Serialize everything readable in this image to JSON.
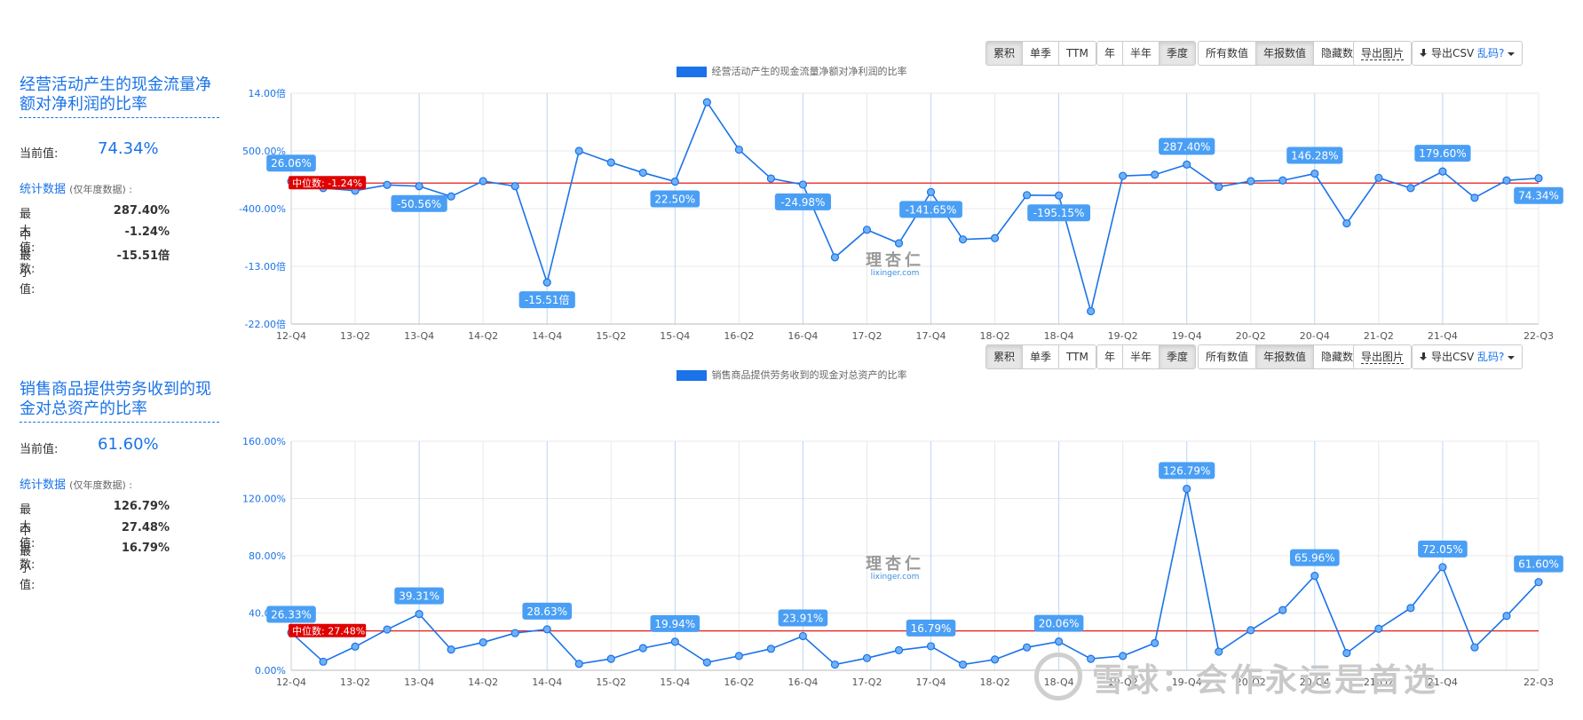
{
  "panels": [
    {
      "title": "经营活动产生的现金流量净额对净利润的比率",
      "current_label": "当前值:",
      "current_value": "74.34%",
      "stats_label": "统计数据",
      "stats_note": "(仅年度数据) :",
      "stats": [
        {
          "label": "最大值:",
          "value": "287.40%"
        },
        {
          "label": "中位数:",
          "value": "-1.24%"
        },
        {
          "label": "最小值:",
          "value": "-15.51倍"
        }
      ],
      "toolbar": {
        "group1": [
          "累积",
          "单季",
          "TTM"
        ],
        "group1_active": 0,
        "group2": [
          "年",
          "半年",
          "季度"
        ],
        "group2_active": 2,
        "group3": [
          "所有数值",
          "年报数值",
          "隐藏数值"
        ],
        "group3_active": 1,
        "export_image": "导出图片",
        "export_csv": "导出CSV",
        "garbled": "乱码?"
      }
    },
    {
      "title": "销售商品提供劳务收到的现金对总资产的比率",
      "current_label": "当前值:",
      "current_value": "61.60%",
      "stats_label": "统计数据",
      "stats_note": "(仅年度数据) :",
      "stats": [
        {
          "label": "最大值:",
          "value": "126.79%"
        },
        {
          "label": "中位数:",
          "value": "27.48%"
        },
        {
          "label": "最小值:",
          "value": "16.79%"
        }
      ],
      "toolbar": {
        "group1": [
          "累积",
          "单季",
          "TTM"
        ],
        "group1_active": 0,
        "group2": [
          "年",
          "半年",
          "季度"
        ],
        "group2_active": 2,
        "group3": [
          "所有数值",
          "年报数值",
          "隐藏数值"
        ],
        "group3_active": 1,
        "export_image": "导出图片",
        "export_csv": "导出CSV",
        "garbled": "乱码?"
      }
    }
  ],
  "watermarks": {
    "lixinger_cn": "理杏仁",
    "lixinger_en": "lixinger.com",
    "xueqiu": "雪球：会作永远是首选"
  },
  "colors": {
    "line": "#1a73e8",
    "median": "#e00000",
    "label_bg": "#4a9ff5",
    "grid": "#e8e8e8",
    "year_grid": "#b9d7f7"
  },
  "chart_data": [
    {
      "type": "line",
      "title": "",
      "legend": "经营活动产生的现金流量净额对净利润的比率",
      "x": [
        "12-Q4",
        "13-Q1",
        "13-Q2",
        "13-Q3",
        "13-Q4",
        "14-Q1",
        "14-Q2",
        "14-Q3",
        "14-Q4",
        "15-Q1",
        "15-Q2",
        "15-Q3",
        "15-Q4",
        "16-Q1",
        "16-Q2",
        "16-Q3",
        "16-Q4",
        "17-Q1",
        "17-Q2",
        "17-Q3",
        "17-Q4",
        "18-Q1",
        "18-Q2",
        "18-Q3",
        "18-Q4",
        "19-Q1",
        "19-Q2",
        "19-Q3",
        "19-Q4",
        "20-Q1",
        "20-Q2",
        "20-Q3",
        "20-Q4",
        "21-Q1",
        "21-Q2",
        "21-Q3",
        "21-Q4",
        "22-Q1",
        "22-Q2",
        "22-Q3"
      ],
      "x_tick_labels": [
        "12-Q4",
        "13-Q2",
        "13-Q4",
        "14-Q2",
        "14-Q4",
        "15-Q2",
        "15-Q4",
        "16-Q2",
        "16-Q4",
        "17-Q2",
        "17-Q4",
        "18-Q2",
        "18-Q4",
        "19-Q2",
        "19-Q4",
        "20-Q2",
        "20-Q4",
        "21-Q2",
        "21-Q4",
        "22-Q3"
      ],
      "y_ticks": [
        "14.00倍",
        "500.00%",
        "-400.00%",
        "-13.00倍",
        "-22.00倍"
      ],
      "y_tick_values": [
        14,
        5,
        -4,
        -13,
        -22
      ],
      "ylim": [
        -22,
        14
      ],
      "values": [
        0.2606,
        -0.8,
        -1.2,
        -0.3,
        -0.5056,
        -2.1,
        0.3,
        -0.5,
        -15.51,
        5.0,
        3.2,
        1.6,
        0.225,
        12.6,
        5.2,
        0.7,
        -0.2498,
        -11.6,
        -7.3,
        -9.4,
        -1.4165,
        -8.8,
        -8.6,
        -1.9,
        -1.9515,
        -20.0,
        1.1,
        1.3,
        2.874,
        -0.6,
        0.3,
        0.4,
        1.4628,
        -6.3,
        0.8,
        -0.8,
        1.796,
        -2.3,
        0.4,
        0.7434
      ],
      "labels": [
        {
          "index": 0,
          "text": "26.06%"
        },
        {
          "index": 4,
          "text": "-50.56%"
        },
        {
          "index": 8,
          "text": "-15.51倍"
        },
        {
          "index": 12,
          "text": "22.50%"
        },
        {
          "index": 16,
          "text": "-24.98%"
        },
        {
          "index": 20,
          "text": "-141.65%"
        },
        {
          "index": 24,
          "text": "-195.15%"
        },
        {
          "index": 28,
          "text": "287.40%"
        },
        {
          "index": 32,
          "text": "146.28%"
        },
        {
          "index": 36,
          "text": "179.60%"
        },
        {
          "index": 39,
          "text": "74.34%"
        }
      ],
      "median": {
        "value": -0.0124,
        "label": "中位数: -1.24%"
      },
      "grid": true,
      "legend_position": "top-center"
    },
    {
      "type": "line",
      "title": "",
      "legend": "销售商品提供劳务收到的现金对总资产的比率",
      "x": [
        "12-Q4",
        "13-Q1",
        "13-Q2",
        "13-Q3",
        "13-Q4",
        "14-Q1",
        "14-Q2",
        "14-Q3",
        "14-Q4",
        "15-Q1",
        "15-Q2",
        "15-Q3",
        "15-Q4",
        "16-Q1",
        "16-Q2",
        "16-Q3",
        "16-Q4",
        "17-Q1",
        "17-Q2",
        "17-Q3",
        "17-Q4",
        "18-Q1",
        "18-Q2",
        "18-Q3",
        "18-Q4",
        "19-Q1",
        "19-Q2",
        "19-Q3",
        "19-Q4",
        "20-Q1",
        "20-Q2",
        "20-Q3",
        "20-Q4",
        "21-Q1",
        "21-Q2",
        "21-Q3",
        "21-Q4",
        "22-Q1",
        "22-Q2",
        "22-Q3"
      ],
      "x_tick_labels": [
        "12-Q4",
        "13-Q2",
        "13-Q4",
        "14-Q2",
        "14-Q4",
        "15-Q2",
        "15-Q4",
        "16-Q2",
        "16-Q4",
        "17-Q2",
        "17-Q4",
        "18-Q2",
        "18-Q4",
        "19-Q2",
        "19-Q4",
        "20-Q2",
        "20-Q4",
        "21-Q2",
        "21-Q4",
        "22-Q3"
      ],
      "y_ticks": [
        "160.00%",
        "120.00%",
        "80.00%",
        "40.00%",
        "0.00%"
      ],
      "y_tick_values": [
        160,
        120,
        80,
        40,
        0
      ],
      "ylim": [
        0,
        160
      ],
      "values": [
        26.33,
        6.0,
        16.5,
        28.5,
        39.31,
        14.5,
        19.5,
        26.0,
        28.63,
        4.5,
        8.0,
        15.5,
        19.94,
        5.5,
        10.0,
        15.0,
        23.91,
        4.0,
        8.5,
        14.0,
        16.79,
        4.0,
        7.5,
        16.0,
        20.06,
        8.0,
        10.0,
        19.0,
        126.79,
        13.0,
        28.0,
        42.0,
        65.96,
        12.0,
        29.0,
        43.5,
        72.05,
        16.0,
        38.0,
        61.6
      ],
      "labels": [
        {
          "index": 0,
          "text": "26.33%"
        },
        {
          "index": 4,
          "text": "39.31%"
        },
        {
          "index": 8,
          "text": "28.63%"
        },
        {
          "index": 12,
          "text": "19.94%"
        },
        {
          "index": 16,
          "text": "23.91%"
        },
        {
          "index": 20,
          "text": "16.79%"
        },
        {
          "index": 24,
          "text": "20.06%"
        },
        {
          "index": 28,
          "text": "126.79%"
        },
        {
          "index": 32,
          "text": "65.96%"
        },
        {
          "index": 36,
          "text": "72.05%"
        },
        {
          "index": 39,
          "text": "61.60%"
        }
      ],
      "median": {
        "value": 27.48,
        "label": "中位数: 27.48%"
      },
      "grid": true,
      "legend_position": "top-center"
    }
  ]
}
